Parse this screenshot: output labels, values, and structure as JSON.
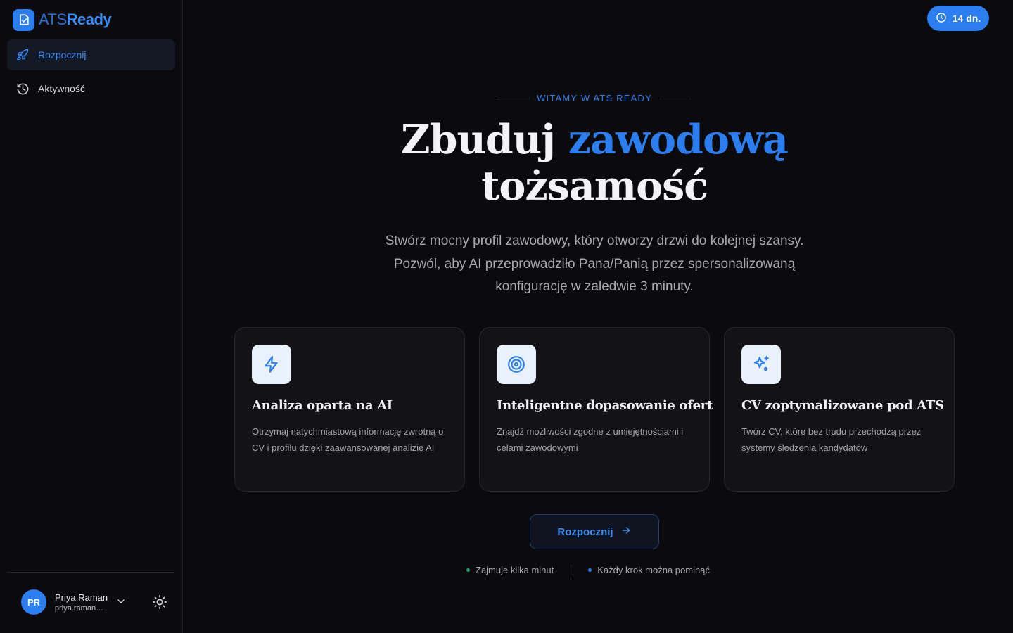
{
  "brand": {
    "ats": "ATS",
    "ready": "Ready"
  },
  "nav": [
    {
      "label": "Rozpocznij",
      "icon": "rocket-icon",
      "active": true
    },
    {
      "label": "Aktywność",
      "icon": "history-icon",
      "active": false
    }
  ],
  "user": {
    "initials": "PR",
    "name": "Priya Raman",
    "email": "priya.raman@example.com"
  },
  "trial": {
    "label": "14 dn.",
    "icon": "clock-icon"
  },
  "hero": {
    "eyebrow": "WITAMY W ATS READY",
    "title_before": "Zbuduj",
    "title_accent": "zawodową",
    "title_after": "tożsamość",
    "subtitle": "Stwórz mocny profil zawodowy, który otworzy drzwi do kolejnej szansy. Pozwól, aby AI przeprowadziło Pana/Panią przez spersonalizowaną konfigurację w zaledwie 3 minuty."
  },
  "features": [
    {
      "icon": "lightning-icon",
      "title": "Analiza oparta na AI",
      "desc": "Otrzymaj natychmiastową informację zwrotną o CV i profilu dzięki zaawansowanej analizie AI"
    },
    {
      "icon": "target-icon",
      "title": "Inteligentne dopasowanie ofert",
      "desc": "Znajdź możliwości zgodne z umiejętnościami i celami zawodowymi"
    },
    {
      "icon": "sparkles-icon",
      "title": "CV zoptymalizowane pod ATS",
      "desc": "Twórz CV, które bez trudu przechodzą przez systemy śledzenia kandydatów"
    }
  ],
  "cta": {
    "label": "Rozpocznij"
  },
  "hints": [
    {
      "text": "Zajmuje kilka minut",
      "color": "#22a06b"
    },
    {
      "text": "Każdy krok można pominąć",
      "color": "#2f80ed"
    }
  ],
  "colors": {
    "accent": "#2a7ef0",
    "background": "#0b0b0d",
    "card": "#131316"
  }
}
